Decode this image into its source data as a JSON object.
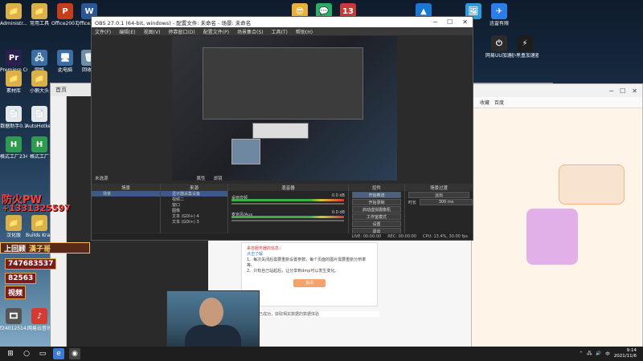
{
  "desktop": {
    "icons": [
      {
        "label": "Administr...",
        "glyph": "📁",
        "color": "#d9b04a"
      },
      {
        "label": "常用工具",
        "glyph": "📁",
        "color": "#d9b04a"
      },
      {
        "label": "Office2007_PPT",
        "glyph": "P",
        "color": "#c43e1c"
      },
      {
        "label": "Office2007",
        "glyph": "W",
        "color": "#2b579a"
      },
      {
        "label": "Premiere CC2019",
        "glyph": "Pr",
        "color": "#2a1f4f"
      },
      {
        "label": "网络",
        "glyph": "🖧",
        "color": "#3a6ea5"
      },
      {
        "label": "此电脑",
        "glyph": "🖥",
        "color": "#3a6ea5"
      },
      {
        "label": "回收站",
        "glyph": "🗑",
        "color": "#6f8fa8"
      },
      {
        "label": "素材库",
        "glyph": "📁",
        "color": "#d9b04a"
      },
      {
        "label": "小鹅大头",
        "glyph": "📁",
        "color": "#d9b04a"
      },
      {
        "label": "数据助手0.1",
        "glyph": "📄",
        "color": "#e8e8e8"
      },
      {
        "label": "AutoHotkey",
        "glyph": "📄",
        "color": "#e8e8e8"
      },
      {
        "label": "格式工厂2345版本",
        "glyph": "H",
        "color": "#2e9c4e"
      },
      {
        "label": "格式工厂",
        "glyph": "H",
        "color": "#2e9c4e"
      },
      {
        "label": "汉化版",
        "glyph": "📁",
        "color": "#d9b04a"
      },
      {
        "label": "Builds Krangle...",
        "glyph": "📁",
        "color": "#d9b04a"
      },
      {
        "label": "f24012514...",
        "glyph": "🎞",
        "color": "#555"
      },
      {
        "label": "网易云音乐",
        "glyph": "♪",
        "color": "#d43c33"
      }
    ],
    "top_icons": [
      {
        "label": "",
        "glyph": "😎",
        "color": "#e8b23a"
      },
      {
        "label": "",
        "glyph": "💬",
        "color": "#2aae67"
      },
      {
        "label": "",
        "glyph": "13",
        "color": "#c83a3a"
      },
      {
        "label": "",
        "glyph": "▲",
        "color": "#1976d2"
      },
      {
        "label": "",
        "glyph": "🖼",
        "color": "#2a9bd8"
      },
      {
        "label": "迅雷有限",
        "glyph": "✈",
        "color": "#2b7de9"
      },
      {
        "label": "网易UU加速器",
        "glyph": "⏻",
        "color": "#2b2b2b"
      },
      {
        "label": "小黑盒加速器",
        "glyph": "⚡",
        "color": "#1d1d1d"
      }
    ]
  },
  "obs": {
    "title": "OBS 27.0.1 (64-bit, windows) - 配置文件: 未命名 - 场景: 未命名",
    "menu": [
      "文件(F)",
      "编辑(E)",
      "视图(V)",
      "停靠窗口(D)",
      "配置文件(P)",
      "场景集合(S)",
      "工具(T)",
      "帮助(H)"
    ],
    "no_source": "未选源",
    "properties_label": "属性",
    "filters_label": "滤镜",
    "docks": {
      "scenes": {
        "title": "场景",
        "items": [
          "场景"
        ]
      },
      "sources": {
        "title": "来源",
        "items": [
          "显示器采集设备",
          "视频二",
          "窗口",
          "图像",
          "文本 (GDI+) 4",
          "文本 (GDI+) 3"
        ]
      },
      "mixer": {
        "title": "混音器",
        "tracks": [
          {
            "name": "桌面音频",
            "level": "0.0 dB"
          },
          {
            "name": "麦克风/Aux",
            "level": "0.0 dB"
          }
        ]
      },
      "transitions": {
        "title": "场景过渡",
        "type": "淡出",
        "duration_label": "时长",
        "duration": "300 ms"
      },
      "controls": {
        "title": "控件",
        "buttons": [
          "开始推流",
          "开始录制",
          "启动虚拟摄像机",
          "工作室模式",
          "设置",
          "退出"
        ]
      }
    },
    "status": [
      "LIVE: 00:00:00",
      "REC: 00:00:00",
      "CPU: 13.4%, 30.00 fps"
    ]
  },
  "overlays": {
    "watermark_1": "防火PW",
    "watermark_2": "+1331325597",
    "live_card_prefix": "上回顾",
    "live_card_name": "漢子哥",
    "tag_1": "747683537",
    "tag_2": "82563",
    "tag_3": "视频"
  },
  "notice": {
    "headline": "来自服务器的信息：",
    "link": "点击了解",
    "lines": [
      "1、每次关闭后需要重新设置参数，每个页面的图片需要重新分辨率等。",
      "2、只有自己站起后，让分享到dmp可以发生变化。"
    ],
    "button": "关闭",
    "footer": "已成功，获取相关数据的数据体验"
  },
  "taskbar": {
    "time": "9:14",
    "date": "2021/11/6",
    "lang": "中"
  },
  "colors": {
    "obs_bg": "#2b2b2b",
    "obs_select": "#3c5a85",
    "red_overlay": "#ff4040"
  }
}
